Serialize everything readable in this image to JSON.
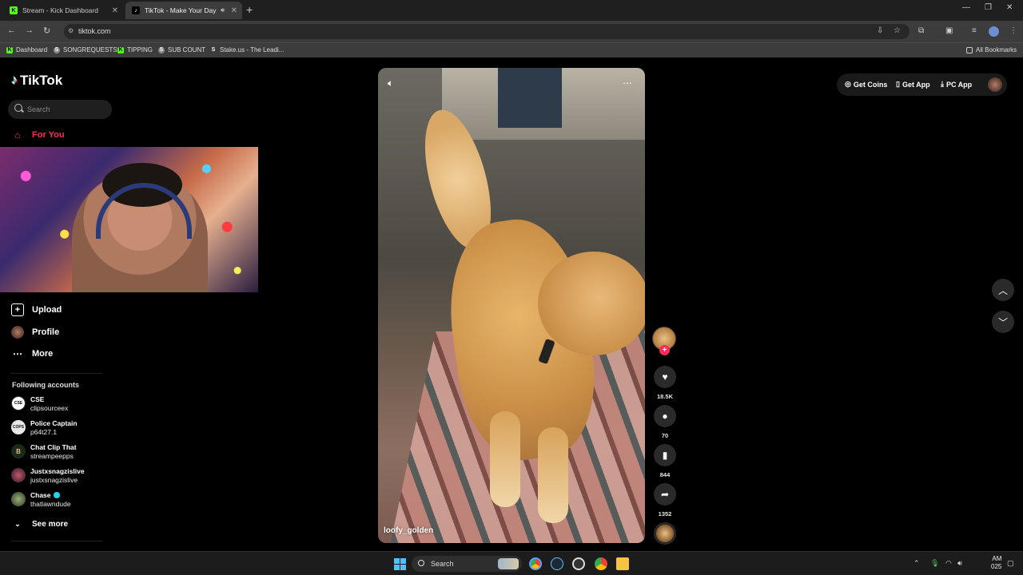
{
  "browser": {
    "tabs": [
      {
        "label": "Stream - Kick Dashboard",
        "favicon": "kick-icon",
        "active": false
      },
      {
        "label": "TikTok - Make Your Day",
        "favicon": "tiktok-icon",
        "active": true
      }
    ],
    "url": "tiktok.com",
    "bookmarks": [
      {
        "label": "Dashboard",
        "icon": "kick-icon"
      },
      {
        "label": "SONGREQUESTS",
        "icon": "streamelements-icon"
      },
      {
        "label": "TIPPING",
        "icon": "kick-icon"
      },
      {
        "label": "SUB COUNT",
        "icon": "streamelements-icon"
      },
      {
        "label": "Stake.us - The Leadi...",
        "icon": "stake-icon"
      }
    ],
    "all_bookmarks": "All Bookmarks"
  },
  "sidebar": {
    "logo": "TikTok",
    "search_placeholder": "Search",
    "for_you": "For You",
    "upload": "Upload",
    "profile": "Profile",
    "more": "More",
    "following_title": "Following accounts",
    "accounts": [
      {
        "name": "CSE",
        "username": "clipsourceex",
        "avatar_text": "CSE",
        "verified": false
      },
      {
        "name": "Police Captain",
        "username": "p64t27.1",
        "avatar_text": "COPS",
        "verified": false
      },
      {
        "name": "Chat Clip That",
        "username": "streampeepps",
        "avatar_text": "B",
        "verified": false
      },
      {
        "name": "Justxsnagzislive",
        "username": "justxsnagzislive",
        "avatar_text": "",
        "verified": false
      },
      {
        "name": "Chase",
        "username": "thatlawndude",
        "avatar_text": "",
        "verified": true
      }
    ],
    "see_more": "See more"
  },
  "video": {
    "username": "loofy_golden"
  },
  "actions": {
    "likes": "18.5K",
    "comments": "70",
    "saves": "844",
    "shares": "1352"
  },
  "topright": {
    "get_coins": "Get Coins",
    "get_app": "Get App",
    "pc_app": "PC App"
  },
  "taskbar": {
    "search": "Search",
    "clock_line1": "AM",
    "clock_line2": "025"
  },
  "colors": {
    "accent": "#fe2c55",
    "verified": "#20d5ec",
    "kick": "#53fc18"
  }
}
